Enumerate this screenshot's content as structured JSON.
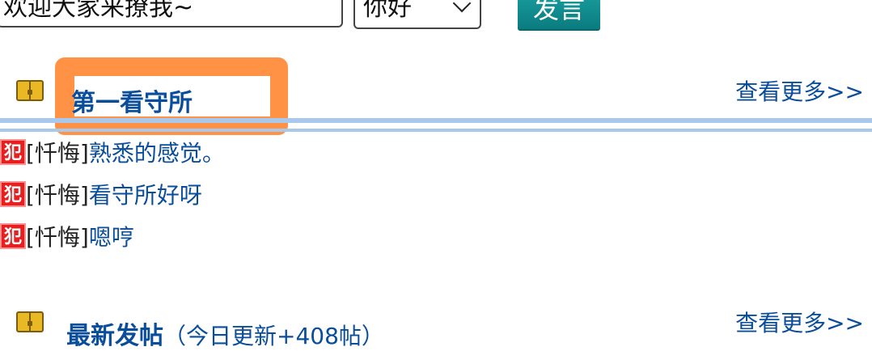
{
  "composer": {
    "message_value": "欢迎大家来撩我~",
    "greeting_selected": "你好",
    "send_label": "发言"
  },
  "sections": [
    {
      "title": "第一看守所",
      "more_label": "查看更多>>",
      "icon": "book-icon",
      "posts": [
        {
          "tag": "犯",
          "category": "[忏悔]",
          "title": "熟悉的感觉。"
        },
        {
          "tag": "犯",
          "category": "[忏悔]",
          "title": "看守所好呀"
        },
        {
          "tag": "犯",
          "category": "[忏悔]",
          "title": "嗯哼"
        }
      ]
    },
    {
      "title": "最新发帖",
      "subtitle": "（今日更新+408帖）",
      "more_label": "查看更多>>",
      "icon": "book-icon"
    }
  ],
  "colors": {
    "link": "#0a4e9b",
    "accent_button": "#0a7a7e",
    "divider": "#a9c9ec",
    "highlight": "#ff8c3a",
    "tag_red": "#e62020"
  }
}
